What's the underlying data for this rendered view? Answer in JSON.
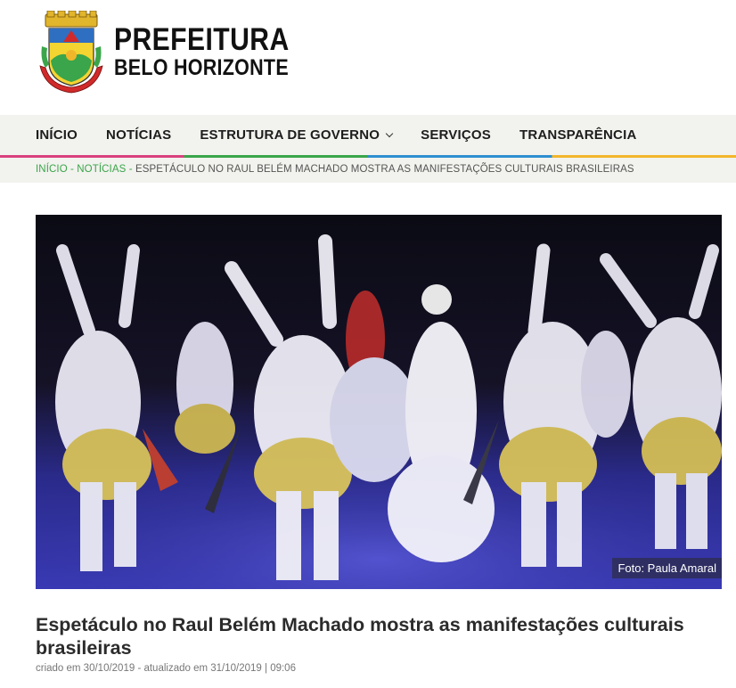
{
  "brand": {
    "line1": "PREFEITURA",
    "line2": "BELO HORIZONTE",
    "crest_icon": "coat-of-arms-icon",
    "colors": {
      "green": "#3aa54a",
      "pink": "#d9417d",
      "blue": "#2e8fd0",
      "yellow": "#f2b62b"
    }
  },
  "nav": {
    "items": [
      {
        "label": "INÍCIO"
      },
      {
        "label": "NOTÍCIAS"
      },
      {
        "label": "ESTRUTURA DE GOVERNO",
        "icon": "chevron-down-icon"
      },
      {
        "label": "SERVIÇOS"
      },
      {
        "label": "TRANSPARÊNCIA"
      }
    ]
  },
  "breadcrumb": {
    "home": "INÍCIO",
    "sep1": " - ",
    "section": "NOTÍCIAS",
    "sep2": " - ",
    "current": "ESPETÁCULO NO RAUL BELÉM MACHADO MOSTRA AS MANIFESTAÇÕES CULTURAIS BRASILEIRAS"
  },
  "article": {
    "photo_credit": "Foto: Paula Amaral",
    "title": "Espetáculo no Raul Belém Machado mostra as manifestações culturais brasileiras",
    "meta": "criado em 30/10/2019 - atualizado em 31/10/2019 | 09:06"
  }
}
